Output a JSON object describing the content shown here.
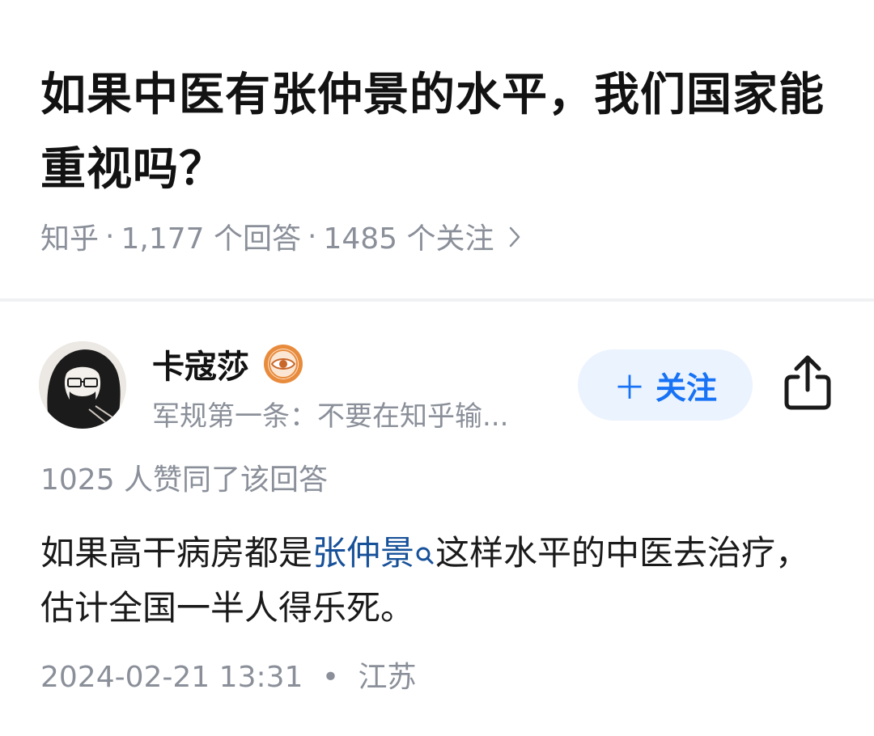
{
  "question": {
    "title": "如果中医有张仲景的水平，我们国家能重视吗？",
    "source": "知乎",
    "answer_count": "1,177 个回答",
    "follower_count": "1485 个关注",
    "separator": "·",
    "chevron_icon": "chevron-right-icon"
  },
  "author": {
    "name": "卡寇莎",
    "badge_icon": "eye-badge-icon",
    "bio": "军规第一条：不要在知乎输...",
    "follow_label": "关注",
    "follow_icon": "plus-icon",
    "share_icon": "share-icon"
  },
  "answer": {
    "vote_summary": "1025 人赞同了该回答",
    "content_before": "如果高干病房都是",
    "link_text": "张仲景",
    "link_icon": "search-icon",
    "content_after": "这样水平的中医去治疗，估计全国一半人得乐死。",
    "date": "2024-02-21 13:31",
    "meta_separator": "•",
    "location": "江苏"
  },
  "colors": {
    "link": "#175199",
    "accent": "#1772f6",
    "follow_bg": "#ebf3fe",
    "meta_gray": "#8a8f99",
    "badge_orange": "#e88b3c"
  }
}
